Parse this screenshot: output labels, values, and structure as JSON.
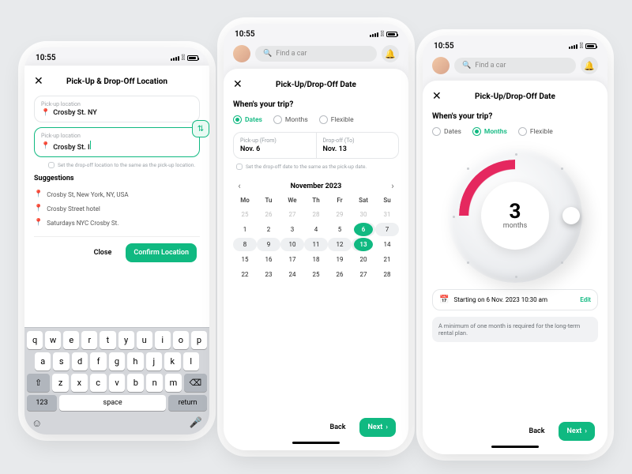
{
  "status_time": "10:55",
  "search_placeholder": "Find a car",
  "screen1": {
    "title": "Pick-Up & Drop-Off Location",
    "pickup_label": "Pick-up location",
    "pickup_value": "Crosby St. NY",
    "dropoff_label": "Pick-up location",
    "dropoff_typing": "Crosby St. I",
    "same_hint": "Set the drop-off location to the same as the pick-up location.",
    "suggestions_title": "Suggestions",
    "sugg": [
      "Crosby St, New York, NY, USA",
      "Crosby Street hotel",
      "Saturdays NYC Crosby St."
    ],
    "close": "Close",
    "confirm": "Confirm Location",
    "kbd_r1": [
      "q",
      "w",
      "e",
      "r",
      "t",
      "y",
      "u",
      "i",
      "o",
      "p"
    ],
    "kbd_r2": [
      "a",
      "s",
      "d",
      "f",
      "g",
      "h",
      "j",
      "k",
      "l"
    ],
    "kbd_r3": [
      "z",
      "x",
      "c",
      "v",
      "b",
      "n",
      "m"
    ],
    "k123": "123",
    "kspace": "space",
    "kreturn": "return"
  },
  "screen2": {
    "title": "Pick-Up/Drop-Off Date",
    "prompt": "When's your trip?",
    "opt_dates": "Dates",
    "opt_months": "Months",
    "opt_flex": "Flexible",
    "pickup_label": "Pick-up (From)",
    "pickup_value": "Nov. 6",
    "dropoff_label": "Drop-off (To)",
    "dropoff_value": "Nov. 13",
    "same_hint": "Set the drop-off date to the same as the pick-up date.",
    "month": "November 2023",
    "wd": [
      "Mo",
      "Tu",
      "We",
      "Th",
      "Fr",
      "Sat",
      "Su"
    ],
    "back": "Back",
    "next": "Next"
  },
  "screen3": {
    "title": "Pick-Up/Drop-Off Date",
    "prompt": "When's your trip?",
    "opt_dates": "Dates",
    "opt_months": "Months",
    "opt_flex": "Flexible",
    "dial_value": "3",
    "dial_unit": "months",
    "start_text": "Starting on 6 Nov. 2023   10:30 am",
    "edit": "Edit",
    "note": "A minimum of one month is required for the long-term rental plan.",
    "back": "Back",
    "next": "Next"
  }
}
